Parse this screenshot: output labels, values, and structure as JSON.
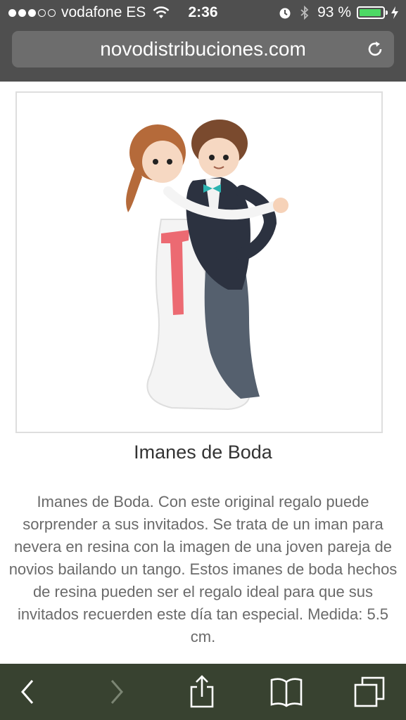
{
  "status_bar": {
    "carrier": "vodafone ES",
    "time": "2:36",
    "battery_percent": "93 %",
    "battery_level": 0.93,
    "signal_bars": 3,
    "signal_total": 5
  },
  "url_bar": {
    "domain": "novodistribuciones.com"
  },
  "product": {
    "title": "Imanes de Boda",
    "description": "Imanes de Boda. Con este original regalo puede sorprender a sus invitados. Se trata de un iman para nevera en resina con la imagen de una joven pareja de novios bailando un tango. Estos imanes de boda hechos de resina pueden ser el regalo ideal para que sus invitados recuerden este día tan especial. Medida: 5.5 cm."
  },
  "toolbar": {
    "icons": [
      "back-icon",
      "forward-icon",
      "share-icon",
      "bookmarks-icon",
      "tabs-icon"
    ]
  },
  "colors": {
    "chrome": "#4f4f4f",
    "url_bar": "#6d6d6d",
    "toolbar": "#384230",
    "battery": "#4cd964"
  }
}
